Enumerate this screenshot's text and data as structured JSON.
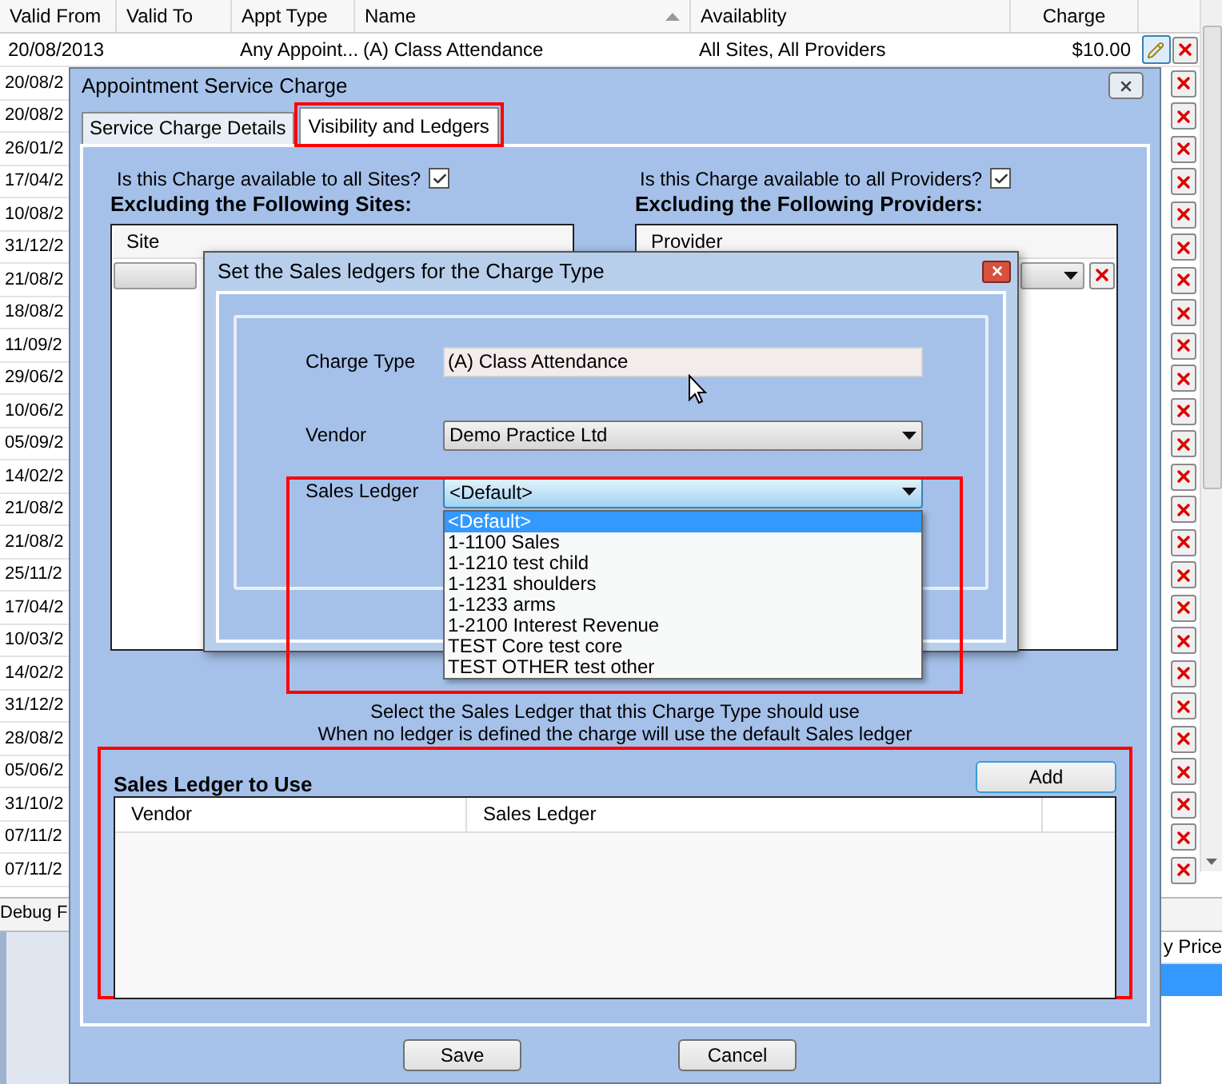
{
  "grid": {
    "columns": [
      {
        "label": "Valid From",
        "sorted": false
      },
      {
        "label": "Valid To",
        "sorted": false
      },
      {
        "label": "Appt Type",
        "sorted": false
      },
      {
        "label": "Name",
        "sorted": true
      },
      {
        "label": "Availablity",
        "sorted": false
      },
      {
        "label": "Charge",
        "sorted": false
      }
    ],
    "first_row": {
      "valid_from": "20/08/2013",
      "appt_type": "Any Appoint...",
      "name": "(A) Class Attendance",
      "availability": "All Sites, All Providers",
      "charge": "$10.00",
      "editable": true
    },
    "rows": [
      {
        "valid_from": "20/08/2"
      },
      {
        "valid_from": "20/08/2"
      },
      {
        "valid_from": "26/01/2"
      },
      {
        "valid_from": "17/04/2"
      },
      {
        "valid_from": "10/08/2"
      },
      {
        "valid_from": "31/12/2"
      },
      {
        "valid_from": "21/08/2"
      },
      {
        "valid_from": "18/08/2"
      },
      {
        "valid_from": "11/09/2"
      },
      {
        "valid_from": "29/06/2"
      },
      {
        "valid_from": "10/06/2"
      },
      {
        "valid_from": "05/09/2"
      },
      {
        "valid_from": "14/02/2"
      },
      {
        "valid_from": "21/08/2"
      },
      {
        "valid_from": "21/08/2"
      },
      {
        "valid_from": "25/11/2"
      },
      {
        "valid_from": "17/04/2"
      },
      {
        "valid_from": "10/03/2"
      },
      {
        "valid_from": "14/02/2"
      },
      {
        "valid_from": "31/12/2"
      },
      {
        "valid_from": "28/08/2"
      },
      {
        "valid_from": "05/06/2"
      },
      {
        "valid_from": "31/10/2"
      },
      {
        "valid_from": "07/11/2"
      },
      {
        "valid_from": "07/11/2"
      }
    ]
  },
  "debug_tab": {
    "label": "Debug F"
  },
  "background_column": {
    "label": "y Price"
  },
  "dialog": {
    "title": "Appointment Service Charge",
    "tabs": [
      {
        "label": "Service Charge Details",
        "selected": false
      },
      {
        "label": "Visibility and Ledgers",
        "selected": true
      }
    ],
    "sites_available": {
      "label": "Is this Charge available to all Sites?",
      "checked": true
    },
    "providers_available": {
      "label": "Is this Charge available to all Providers?",
      "checked": true
    },
    "sites_heading": "Excluding the Following Sites:",
    "sites_column": "Site",
    "providers_heading": "Excluding the Following Providers:",
    "providers_column": "Provider",
    "ledger_dialog": {
      "title": "Set the Sales ledgers for the Charge Type",
      "charge_type": {
        "label": "Charge Type",
        "value": "(A) Class Attendance"
      },
      "vendor": {
        "label": "Vendor",
        "value": "Demo Practice Ltd"
      },
      "sales_ledger": {
        "label": "Sales Ledger",
        "value": "<Default>",
        "expanded": true,
        "options": [
          {
            "label": "<Default>",
            "selected": true
          },
          {
            "label": "1-1100 Sales",
            "selected": false
          },
          {
            "label": "1-1210 test child",
            "selected": false
          },
          {
            "label": "1-1231 shoulders",
            "selected": false
          },
          {
            "label": "1-1233 arms",
            "selected": false
          },
          {
            "label": "1-2100 Interest Revenue",
            "selected": false
          },
          {
            "label": "TEST Core test core",
            "selected": false
          },
          {
            "label": "TEST OTHER test other",
            "selected": false
          }
        ]
      }
    },
    "help_lines": [
      "Select the Sales Ledger that this Charge Type should use",
      "When no ledger is defined the charge will use the default Sales ledger"
    ],
    "ledger_section": {
      "title": "Sales Ledger to Use",
      "add_button": "Add",
      "columns": [
        "Vendor",
        "Sales Ledger"
      ]
    },
    "buttons": [
      "Save",
      "Cancel"
    ]
  }
}
